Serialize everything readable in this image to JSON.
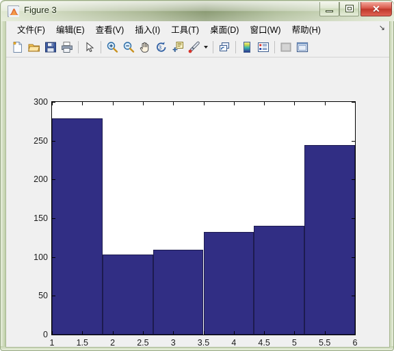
{
  "window": {
    "title": "Figure 3",
    "icon": "matlab-membrane-icon",
    "controls": {
      "minimize_label": "–",
      "maximize_label": "□",
      "close_label": "✕"
    }
  },
  "menubar": {
    "items": [
      {
        "label": "文件(F)",
        "name": "menu-file"
      },
      {
        "label": "编辑(E)",
        "name": "menu-edit"
      },
      {
        "label": "查看(V)",
        "name": "menu-view"
      },
      {
        "label": "插入(I)",
        "name": "menu-insert"
      },
      {
        "label": "工具(T)",
        "name": "menu-tools"
      },
      {
        "label": "桌面(D)",
        "name": "menu-desktop"
      },
      {
        "label": "窗口(W)",
        "name": "menu-window"
      },
      {
        "label": "帮助(H)",
        "name": "menu-help"
      }
    ],
    "overflow_label": "↘"
  },
  "toolbar": {
    "buttons": [
      "new-figure-icon",
      "open-file-icon",
      "save-figure-icon",
      "print-figure-icon",
      "separator",
      "edit-plot-arrow-icon",
      "separator",
      "zoom-in-icon",
      "zoom-out-icon",
      "pan-icon",
      "rotate-3d-icon",
      "data-cursor-icon",
      "brush-icon",
      "brush-dropdown-arrow",
      "separator",
      "link-plot-icon",
      "separator",
      "insert-colorbar-icon",
      "insert-legend-icon",
      "separator",
      "hide-plot-tools-icon",
      "show-plot-tools-icon"
    ]
  },
  "chart_data": {
    "type": "bar",
    "title": "",
    "xlabel": "",
    "ylabel": "",
    "categories": [
      "1-1.833",
      "1.833-2.667",
      "2.667-3.5",
      "3.5-4.333",
      "4.333-5.167",
      "5.167-6"
    ],
    "bar_centers": [
      1.417,
      2.25,
      3.083,
      3.917,
      4.75,
      5.583
    ],
    "bar_edges": [
      1,
      1.833,
      2.667,
      3.5,
      4.333,
      5.167,
      6
    ],
    "values": [
      279,
      103,
      109,
      132,
      140,
      244
    ],
    "xlim": [
      1,
      6
    ],
    "ylim": [
      0,
      300
    ],
    "xticks": [
      1,
      1.5,
      2,
      2.5,
      3,
      3.5,
      4,
      4.5,
      5,
      5.5,
      6
    ],
    "xtick_labels": [
      "1",
      "1.5",
      "2",
      "2.5",
      "3",
      "3.5",
      "4",
      "4.5",
      "5",
      "5.5",
      "6"
    ],
    "yticks": [
      0,
      50,
      100,
      150,
      200,
      250,
      300
    ],
    "ytick_labels": [
      "0",
      "50",
      "100",
      "150",
      "200",
      "250",
      "300"
    ],
    "grid": false,
    "legend": null,
    "bar_color": "#312e84",
    "bar_edge_color": "#1d1b4f",
    "axes_background": "#ffffff",
    "figure_background": "#f0f0f0"
  }
}
